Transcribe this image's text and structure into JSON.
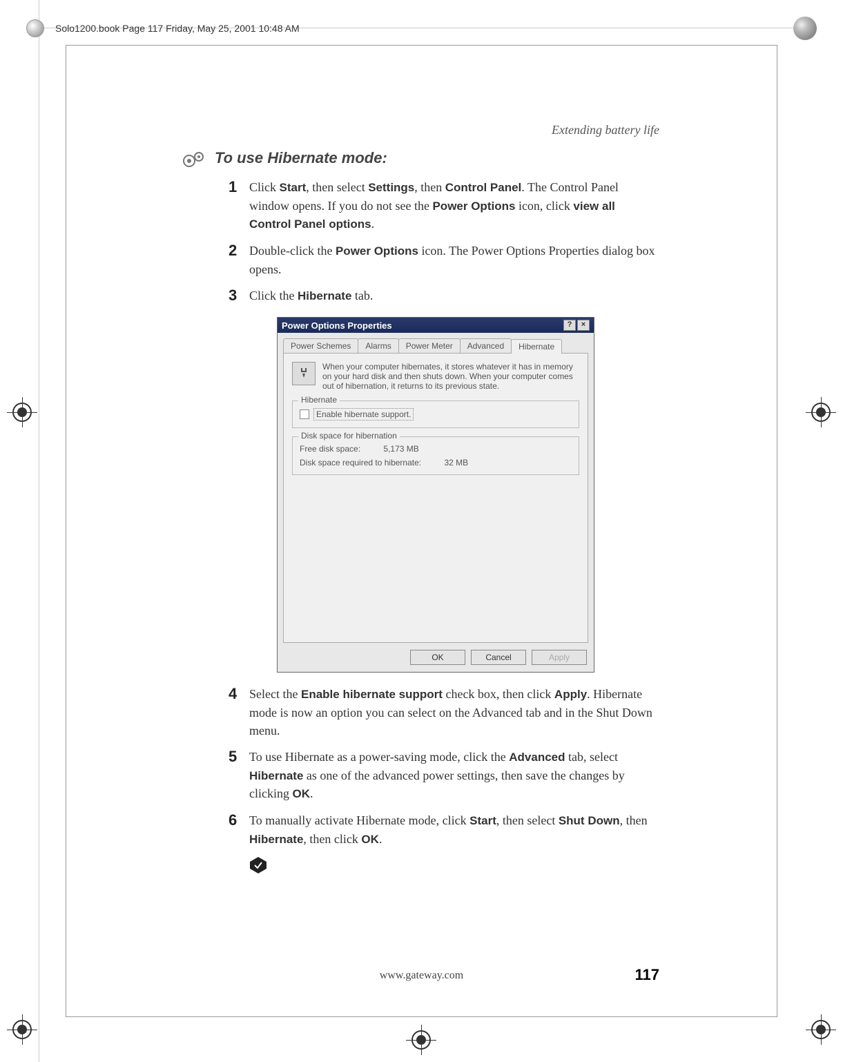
{
  "print": {
    "header": "Solo1200.book  Page 117  Friday, May 25, 2001  10:48 AM"
  },
  "page": {
    "running_head": "Extending battery life",
    "heading": "To use Hibernate mode:",
    "footer_url": "www.gateway.com",
    "page_number": "117"
  },
  "steps": {
    "s1": {
      "num": "1",
      "t1": "Click ",
      "k1": "Start",
      "t2": ", then select ",
      "k2": "Settings",
      "t3": ", then ",
      "k3": "Control Panel",
      "t4": ". The Control Panel window opens. If you do not see the ",
      "k4": "Power Options",
      "t5": " icon, click ",
      "k5": "view all Control Panel options",
      "t6": "."
    },
    "s2": {
      "num": "2",
      "t1": "Double-click the ",
      "k1": "Power Options",
      "t2": " icon. The Power Options Properties dialog box opens."
    },
    "s3": {
      "num": "3",
      "t1": "Click the ",
      "k1": "Hibernate",
      "t2": " tab."
    },
    "s4": {
      "num": "4",
      "t1": "Select the ",
      "k1": "Enable hibernate support",
      "t2": " check box, then click ",
      "k2": "Apply",
      "t3": ". Hibernate mode is now an option you can select on the Advanced tab and in the Shut Down menu."
    },
    "s5": {
      "num": "5",
      "t1": "To use Hibernate as a power-saving mode, click the ",
      "k1": "Advanced",
      "t2": " tab, select ",
      "k2": "Hibernate",
      "t3": " as one of the advanced power settings, then save the changes by clicking ",
      "k3": "OK",
      "t4": "."
    },
    "s6": {
      "num": "6",
      "t1": "To manually activate Hibernate mode, click ",
      "k1": "Start",
      "t2": ", then select ",
      "k2": "Shut Down",
      "t3": ", then ",
      "k3": "Hibernate",
      "t4": ", then click ",
      "k4": "OK",
      "t5": "."
    }
  },
  "dialog": {
    "title": "Power Options Properties",
    "help_btn": "?",
    "close_btn": "×",
    "tabs": {
      "t1": "Power Schemes",
      "t2": "Alarms",
      "t3": "Power Meter",
      "t4": "Advanced",
      "t5": "Hibernate"
    },
    "info_text": "When your computer hibernates, it stores whatever it has in memory on your hard disk and then shuts down. When your computer comes out of hibernation, it returns to its previous state.",
    "hibernate_legend": "Hibernate",
    "enable_label": "Enable hibernate support.",
    "disk_legend": "Disk space for hibernation",
    "free_label": "Free disk space:",
    "free_value": "5,173 MB",
    "req_label": "Disk space required to hibernate:",
    "req_value": "32 MB",
    "ok": "OK",
    "cancel": "Cancel",
    "apply": "Apply"
  }
}
